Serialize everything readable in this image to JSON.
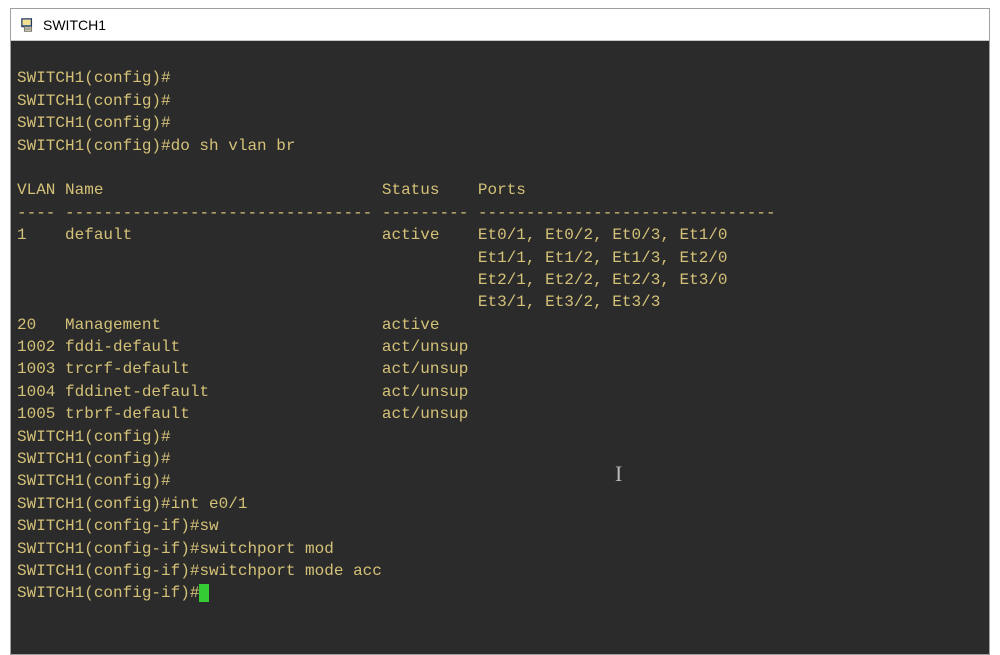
{
  "window": {
    "title": "SWITCH1"
  },
  "terminal": {
    "prompt_config": "SWITCH1(config)#",
    "prompt_configif": "SWITCH1(config-if)#",
    "cmd_vlan": "do sh vlan br",
    "cmd_int": "int e0/1",
    "cmd_sw": "sw",
    "cmd_swmod": "switchport mod",
    "cmd_swmodeacc": "switchport mode acc",
    "header": {
      "vlan": "VLAN",
      "name": "Name",
      "status": "Status",
      "ports": "Ports"
    },
    "sep": {
      "c1": "----",
      "c2": "--------------------------------",
      "c3": "---------",
      "c4": "-------------------------------"
    },
    "vlans": [
      {
        "id": "1",
        "name": "default",
        "status": "active",
        "ports1": "Et0/1, Et0/2, Et0/3, Et1/0",
        "ports2": "Et1/1, Et1/2, Et1/3, Et2/0",
        "ports3": "Et2/1, Et2/2, Et2/3, Et3/0",
        "ports4": "Et3/1, Et3/2, Et3/3"
      },
      {
        "id": "20",
        "name": "Management",
        "status": "active",
        "ports1": ""
      },
      {
        "id": "1002",
        "name": "fddi-default",
        "status": "act/unsup",
        "ports1": ""
      },
      {
        "id": "1003",
        "name": "trcrf-default",
        "status": "act/unsup",
        "ports1": ""
      },
      {
        "id": "1004",
        "name": "fddinet-default",
        "status": "act/unsup",
        "ports1": ""
      },
      {
        "id": "1005",
        "name": "trbrf-default",
        "status": "act/unsup",
        "ports1": ""
      }
    ]
  }
}
